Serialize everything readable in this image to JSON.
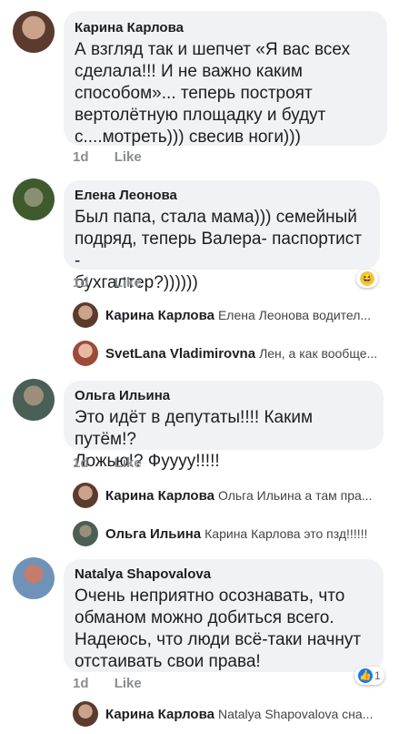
{
  "comments": [
    {
      "author": "Карина Карлова",
      "lines": [
        "А взгляд так и шепчет «Я вас всех",
        "сделала!!! И не важно каким",
        "способом»... теперь построят",
        "вертолётную площадку и будут",
        "с....мотреть))) свесив ноги)))"
      ],
      "time": "1d",
      "like": "Like"
    },
    {
      "author": "Елена Леонова",
      "lines": [
        "Был папа, стала мама))) семейный",
        "подряд, теперь Валера- паспортист -",
        "бухгалтер?))))))"
      ],
      "time": "1d",
      "like": "Like",
      "reaction": {
        "emoji": "😆",
        "count": ""
      },
      "replies": [
        {
          "author": "Карина Карлова",
          "text": "Елена Леонова  водител..."
        },
        {
          "author": "SvetLana Vladimirovna",
          "text": "Лен, а как вообще..."
        }
      ]
    },
    {
      "author": "Ольга Ильина",
      "lines": [
        "Это идёт в депутаты!!!! Каким путём!?",
        "Ложью!? Фуууу!!!!!"
      ],
      "time": "1d",
      "like": "Like",
      "replies": [
        {
          "author": "Карина Карлова",
          "text": "Ольга Ильина а там пра..."
        },
        {
          "author": "Ольга Ильина",
          "text": "Карина Карлова это пзд!!!!!!"
        }
      ]
    },
    {
      "author": "Natalya Shapovalova",
      "lines": [
        "Очень неприятно осознавать, что",
        "обманом можно добиться всего.",
        "Надеюсь, что люди всё-таки  начнут",
        "отстаивать  свои права!"
      ],
      "time": "1d",
      "like": "Like",
      "reaction": {
        "emoji": "👍❤",
        "count": "1"
      },
      "replies": [
        {
          "author": "Карина Карлова",
          "text": "Natalya Shapovalova  сна..."
        }
      ]
    }
  ],
  "colors": {
    "bubble": "#f0f2f5",
    "meta": "#8a8d91",
    "like_blue": "#1877f2"
  }
}
